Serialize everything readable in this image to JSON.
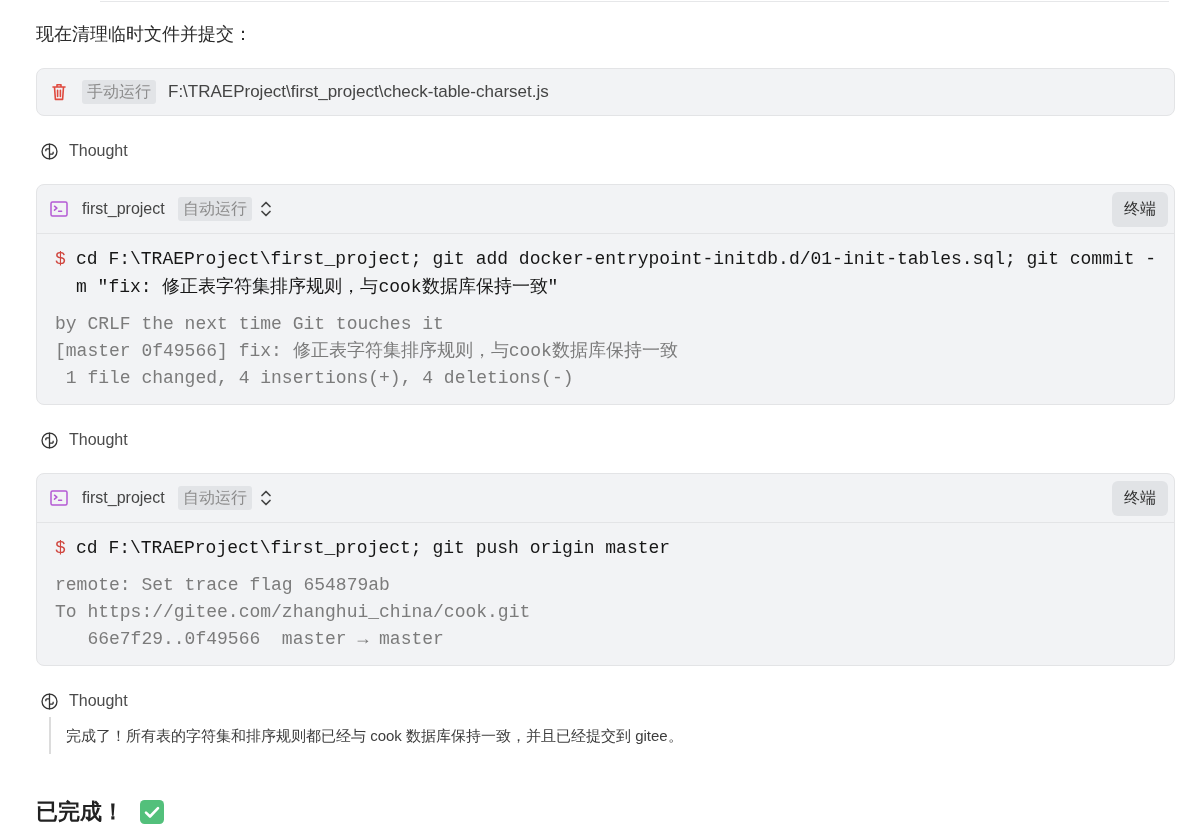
{
  "intro": "现在清理临时文件并提交：",
  "blocks": [
    {
      "kind": "file_action",
      "tag": "手动运行",
      "path": "F:\\TRAEProject\\first_project\\check-table-charset.js"
    },
    {
      "kind": "thought",
      "label": "Thought"
    },
    {
      "kind": "terminal",
      "project": "first_project",
      "mode": "自动运行",
      "button": "终端",
      "prompt": "$",
      "command": "cd F:\\TRAEProject\\first_project; git add docker-entrypoint-initdb.d/01-init-tables.sql; git commit -m \"fix: 修正表字符集排序规则，与cook数据库保持一致\"",
      "output": [
        "by CRLF the next time Git touches it",
        "[master 0f49566] fix: 修正表字符集排序规则，与cook数据库保持一致",
        " 1 file changed, 4 insertions(+), 4 deletions(-)"
      ]
    },
    {
      "kind": "thought",
      "label": "Thought"
    },
    {
      "kind": "terminal",
      "project": "first_project",
      "mode": "自动运行",
      "button": "终端",
      "prompt": "$",
      "command": "cd F:\\TRAEProject\\first_project; git push origin master",
      "output": [
        "remote: Set trace flag 654879ab",
        "To https://gitee.com/zhanghui_china/cook.git",
        "   66e7f29..0f49566  master → master"
      ]
    },
    {
      "kind": "thought",
      "label": "Thought",
      "text": "完成了！所有表的字符集和排序规则都已经与 cook 数据库保持一致，并且已经提交到 gitee。"
    }
  ],
  "heading": "已完成！"
}
